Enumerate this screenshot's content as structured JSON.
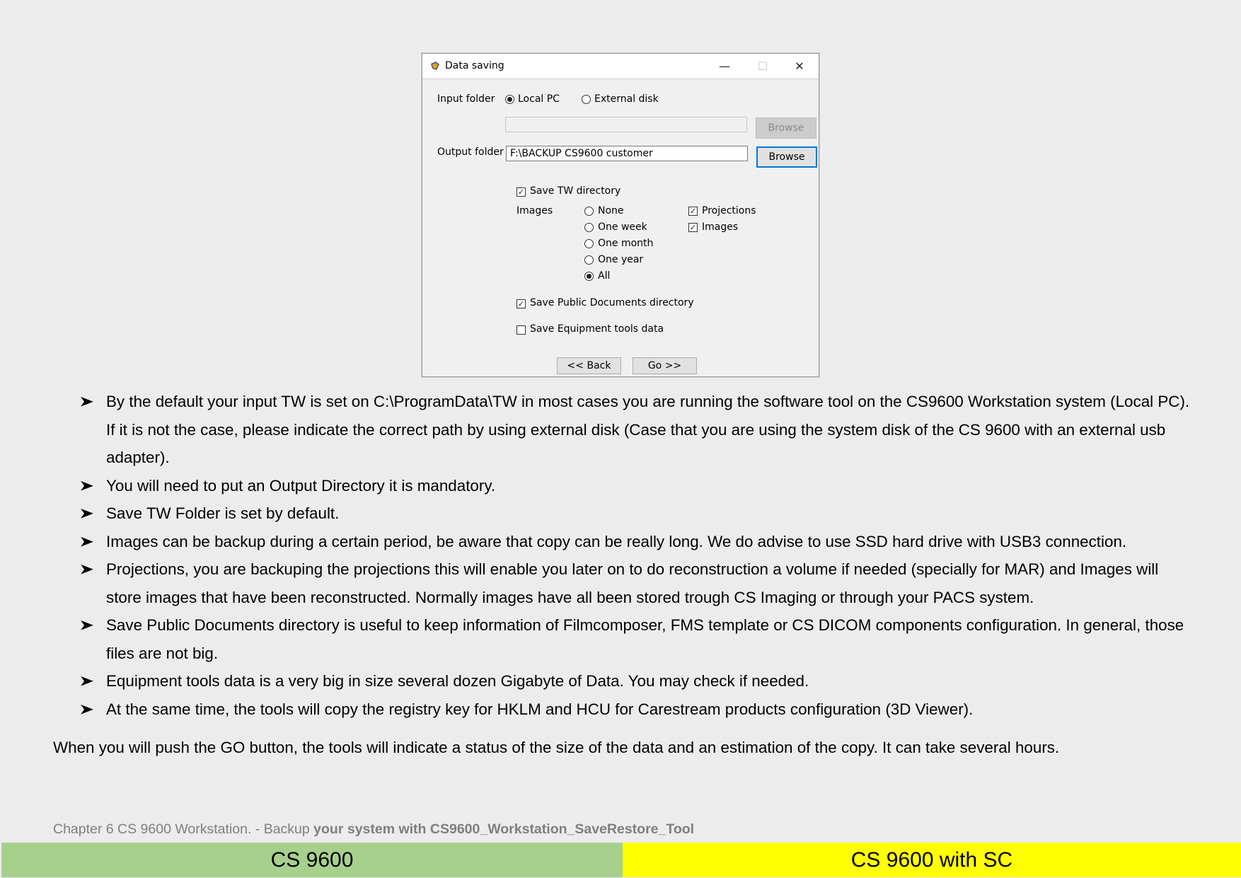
{
  "dialog": {
    "title": "Data saving",
    "input_folder_label": "Input folder",
    "input_options": [
      {
        "label": "Local PC",
        "selected": true
      },
      {
        "label": "External disk",
        "selected": false
      }
    ],
    "input_path_value": "",
    "browse_label": "Browse",
    "output_folder_label": "Output folder",
    "output_path_value": "F:\\BACKUP CS9600 customer",
    "save_tw_label": "Save TW directory",
    "save_tw_checked": true,
    "images_label": "Images",
    "period_options": [
      {
        "label": "None",
        "selected": false
      },
      {
        "label": "One week",
        "selected": false
      },
      {
        "label": "One month",
        "selected": false
      },
      {
        "label": "One year",
        "selected": false
      },
      {
        "label": "All",
        "selected": true
      }
    ],
    "content_options": [
      {
        "label": "Projections",
        "checked": true
      },
      {
        "label": "Images",
        "checked": true
      }
    ],
    "save_public_label": "Save Public Documents directory",
    "save_public_checked": true,
    "save_equipment_label": "Save Equipment tools data",
    "save_equipment_checked": false,
    "back_label": "<< Back",
    "go_label": "Go >>"
  },
  "bullets": [
    "By the default your input TW is set on C:\\ProgramData\\TW in most cases you are running the software tool on the CS9600 Workstation system (Local PC). If it is not the case, please indicate the correct path by using external disk (Case that you are using the system disk of the CS 9600 with an external usb adapter).",
    "You will need to put an Output Directory it is mandatory.",
    "Save TW Folder is set by default.",
    "Images can be backup during a certain period, be aware that copy can be really long. We do advise to use SSD hard drive with USB3 connection.",
    "Projections, you are backuping the projections this will enable you later on to do reconstruction a volume if needed (specially for MAR) and Images will store images that have been reconstructed. Normally images have all been stored trough CS Imaging or through your PACS system.",
    "Save Public Documents directory is useful to keep information of Filmcomposer, FMS template or CS DICOM components configuration. In general, those files are not big.",
    "Equipment tools data is a very big in size several dozen Gigabyte of Data. You may check if needed.",
    "At the same time, the tools will copy the registry key for HKLM and HCU for Carestream products configuration (3D Viewer)."
  ],
  "closing_text": "When you will push the GO button, the tools will indicate a status of the size of the data and an estimation of the copy. It can take several hours.",
  "footer": {
    "chapter_normal": "Chapter 6 CS 9600 Workstation. ",
    "chapter_mid": "- Backup ",
    "chapter_bold": "your system with CS9600_Workstation_SaveRestore_Tool",
    "left_tag": "CS 9600",
    "right_tag": "CS 9600 with SC",
    "left_color": "#a8d08d",
    "right_color": "#ffff00"
  }
}
